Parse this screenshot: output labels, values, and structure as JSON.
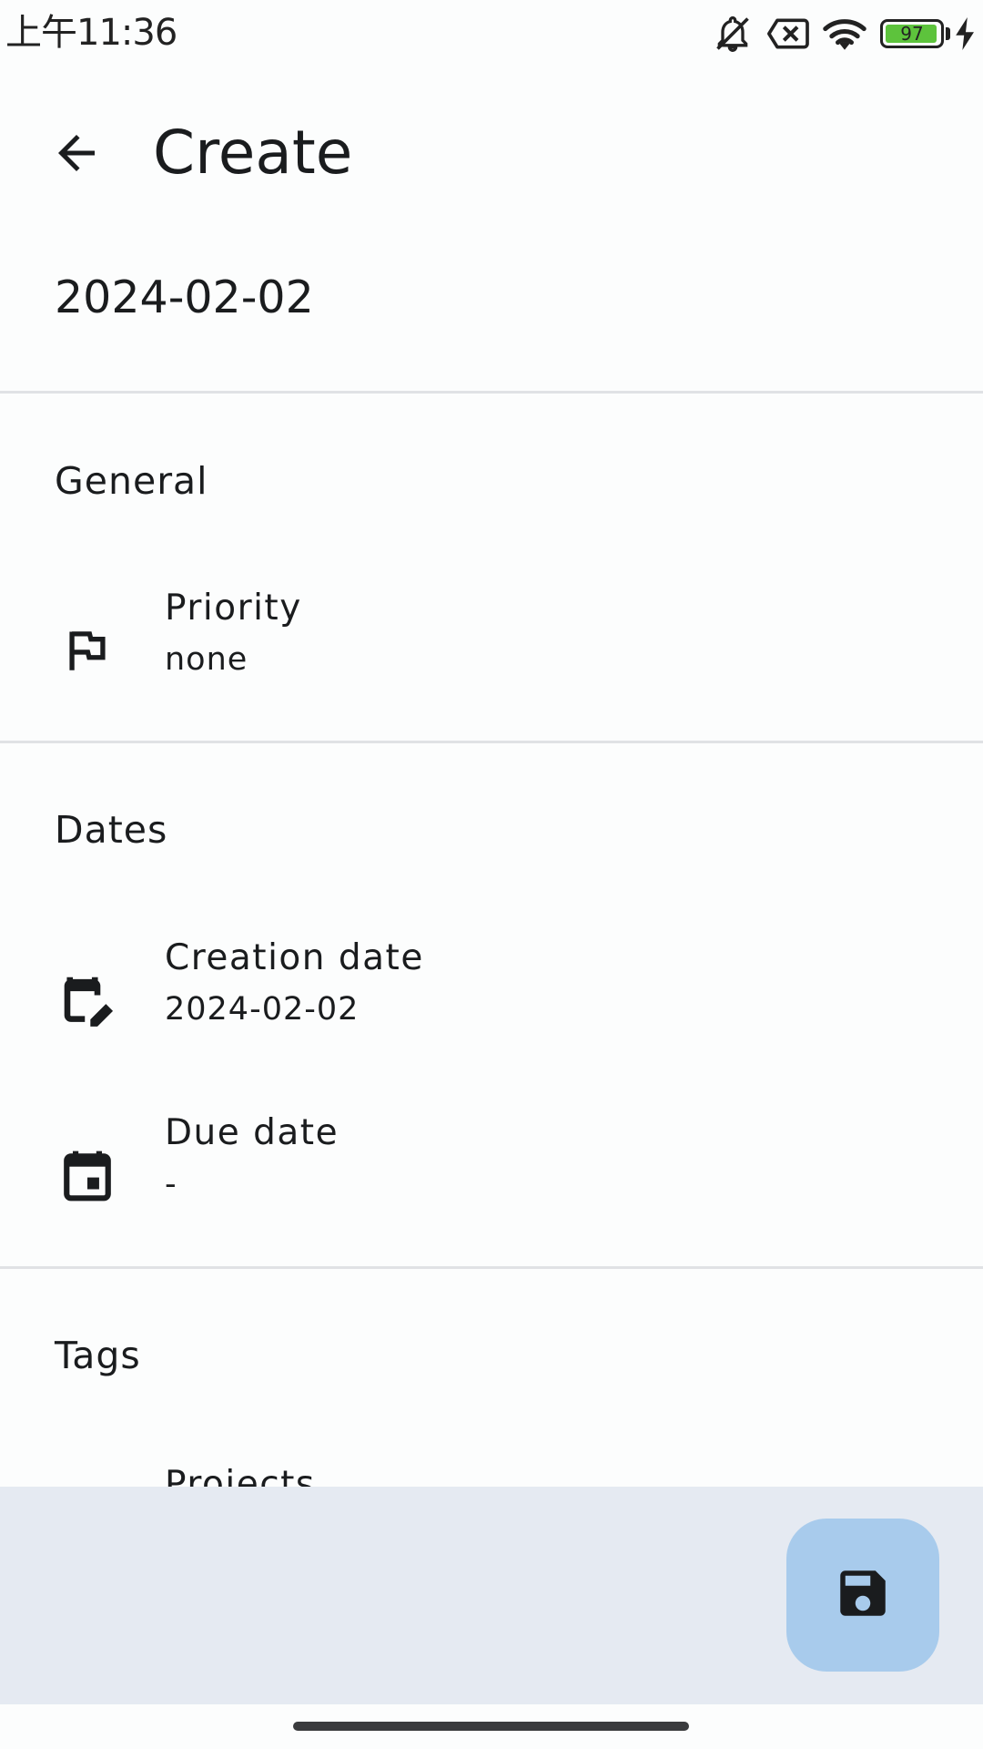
{
  "status_bar": {
    "time": "上午11:36",
    "icons": [
      "bell-off-icon",
      "sim-none-icon",
      "wifi-icon",
      "battery-icon",
      "charging-icon"
    ],
    "battery_level": "97",
    "battery_fraction": 0.97,
    "battery_color": "#5DC33C"
  },
  "app_bar": {
    "title": "Create",
    "back_icon": "arrow-back-icon"
  },
  "task": {
    "title": "2024-02-02"
  },
  "sections": {
    "general": {
      "header": "General",
      "priority": {
        "label": "Priority",
        "value": "none",
        "icon": "flag-icon"
      }
    },
    "dates": {
      "header": "Dates",
      "creation": {
        "label": "Creation date",
        "value": "2024-02-02",
        "icon": "calendar-edit-icon"
      },
      "due": {
        "label": "Due date",
        "value": "-",
        "icon": "calendar-today-icon"
      }
    },
    "tags": {
      "header": "Tags",
      "projects": {
        "label": "Projects",
        "icon": "tag-icon"
      }
    }
  },
  "fab": {
    "icon": "save-icon",
    "color": "#A8CBEC"
  },
  "colors": {
    "background": "#FCFDFD",
    "bottom_bar": "#E5EAF2",
    "divider": "#E0E2E5"
  }
}
